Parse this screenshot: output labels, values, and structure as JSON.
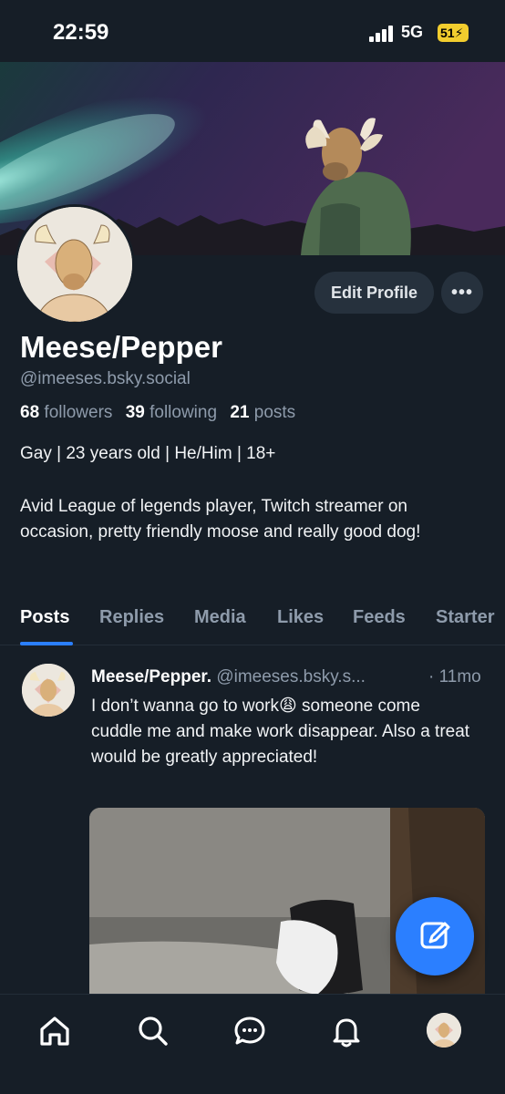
{
  "status_bar": {
    "time": "22:59",
    "network": "5G",
    "battery": "51"
  },
  "profile": {
    "display_name": "Meese/Pepper",
    "handle": "@imeeses.bsky.social",
    "followers_count": "68",
    "followers_label": "followers",
    "following_count": "39",
    "following_label": "following",
    "posts_count": "21",
    "posts_label": "posts",
    "tagline": "Gay | 23 years old | He/Him | 18+",
    "bio": "Avid League of legends player, Twitch streamer on occasion, pretty friendly moose and really good dog!"
  },
  "actions": {
    "edit_label": "Edit Profile",
    "more_label": "•••"
  },
  "tabs": [
    {
      "label": "Posts",
      "active": true
    },
    {
      "label": "Replies",
      "active": false
    },
    {
      "label": "Media",
      "active": false
    },
    {
      "label": "Likes",
      "active": false
    },
    {
      "label": "Feeds",
      "active": false
    },
    {
      "label": "Starter",
      "active": false
    }
  ],
  "post": {
    "author": "Meese/Pepper.",
    "handle": "@imeeses.bsky.s...",
    "time": "· 11mo",
    "text": "I don’t wanna go to work😩 someone come cuddle me and make work disappear. Also a treat would be greatly appreciated!"
  },
  "icons": {
    "fab": "compose-icon",
    "nav": [
      "home-icon",
      "search-icon",
      "chat-icon",
      "bell-icon",
      "profile-avatar"
    ]
  },
  "colors": {
    "background": "#161e27",
    "accent": "#2b7fff",
    "muted_text": "#8e9bab",
    "button_bg": "#26313d"
  }
}
